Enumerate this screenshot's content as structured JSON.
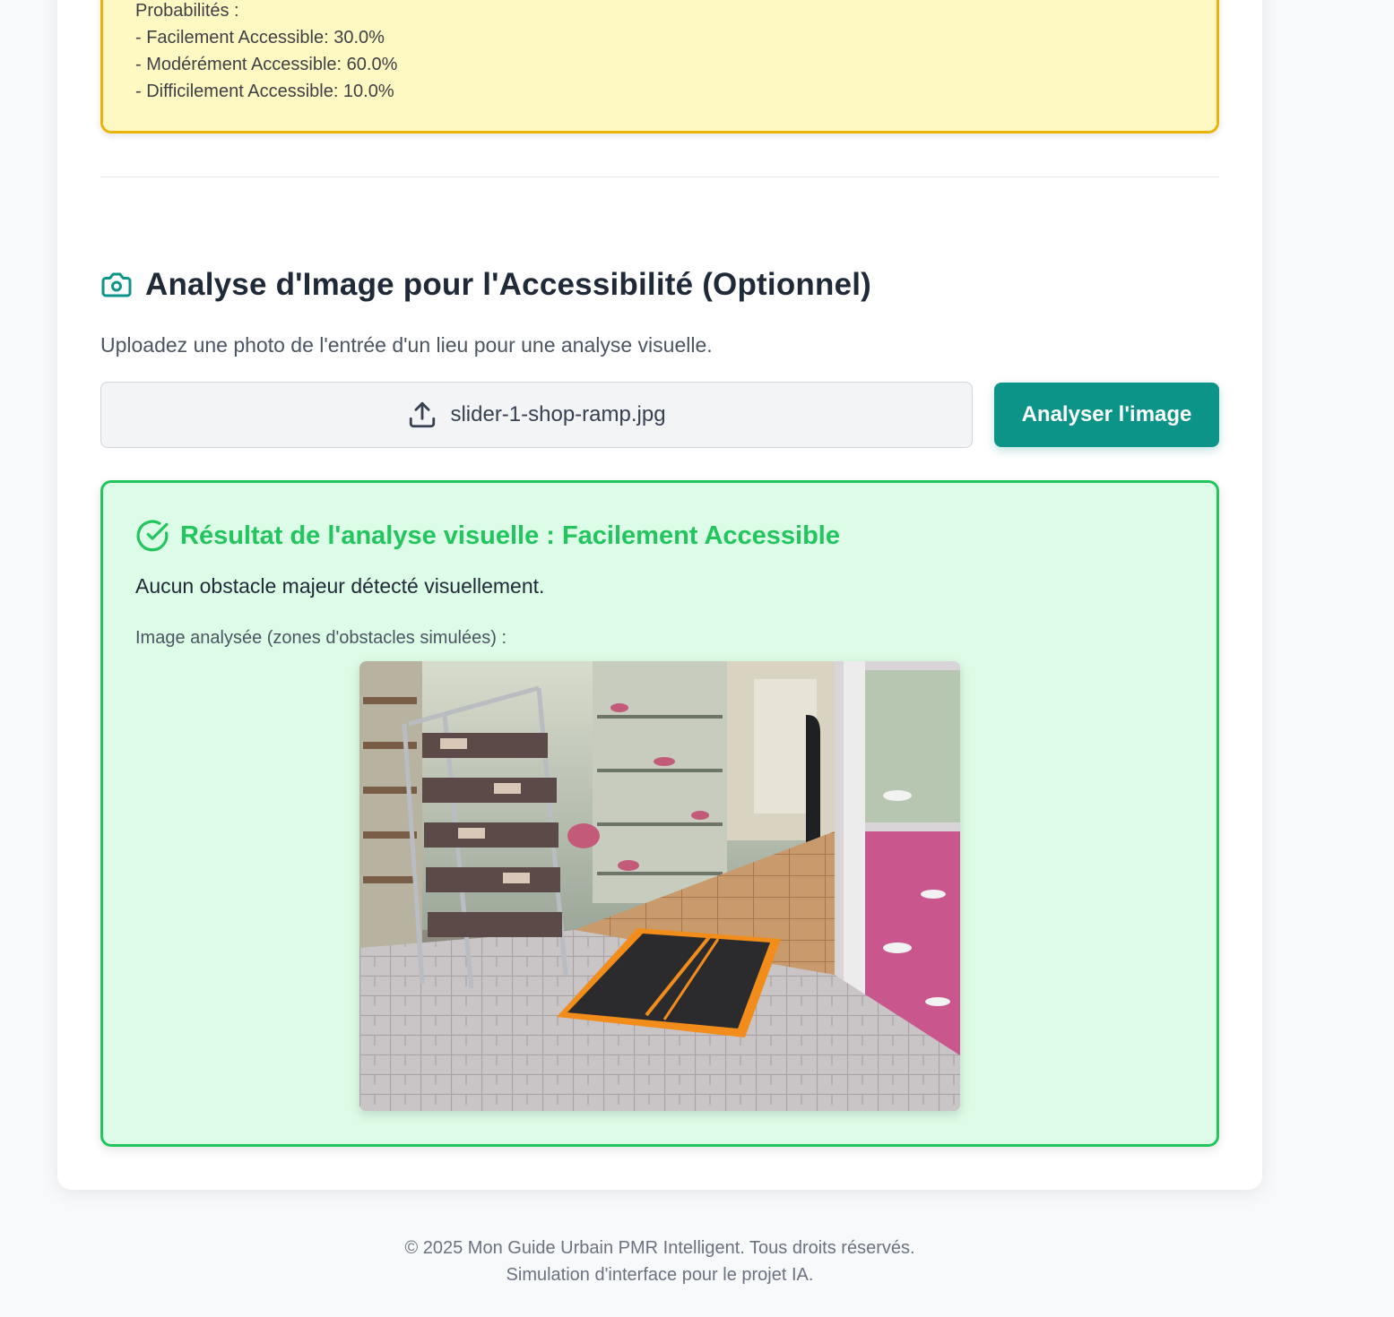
{
  "probabilities": {
    "heading": "Probabilités :",
    "lines": [
      "- Facilement Accessible: 30.0%",
      "- Modérément Accessible: 60.0%",
      "- Difficilement Accessible: 10.0%"
    ]
  },
  "image_section": {
    "icon": "camera-icon",
    "title": "Analyse d'Image pour l'Accessibilité (Optionnel)",
    "subtitle": "Uploadez une photo de l'entrée d'un lieu pour une analyse visuelle.",
    "file_icon": "upload-icon",
    "file_name": "slider-1-shop-ramp.jpg",
    "analyze_button": "Analyser l'image",
    "accent_color": "#0d9488"
  },
  "result": {
    "icon": "check-circle-icon",
    "title": "Résultat de l'analyse visuelle : Facilement Accessible",
    "description": "Aucun obstacle majeur détecté visuellement.",
    "image_label": "Image analysée (zones d'obstacles simulées) :",
    "status_color": "#22c55e"
  },
  "footer": {
    "line1": "© 2025 Mon Guide Urbain PMR Intelligent. Tous droits réservés.",
    "line2": "Simulation d'interface pour le projet IA."
  }
}
